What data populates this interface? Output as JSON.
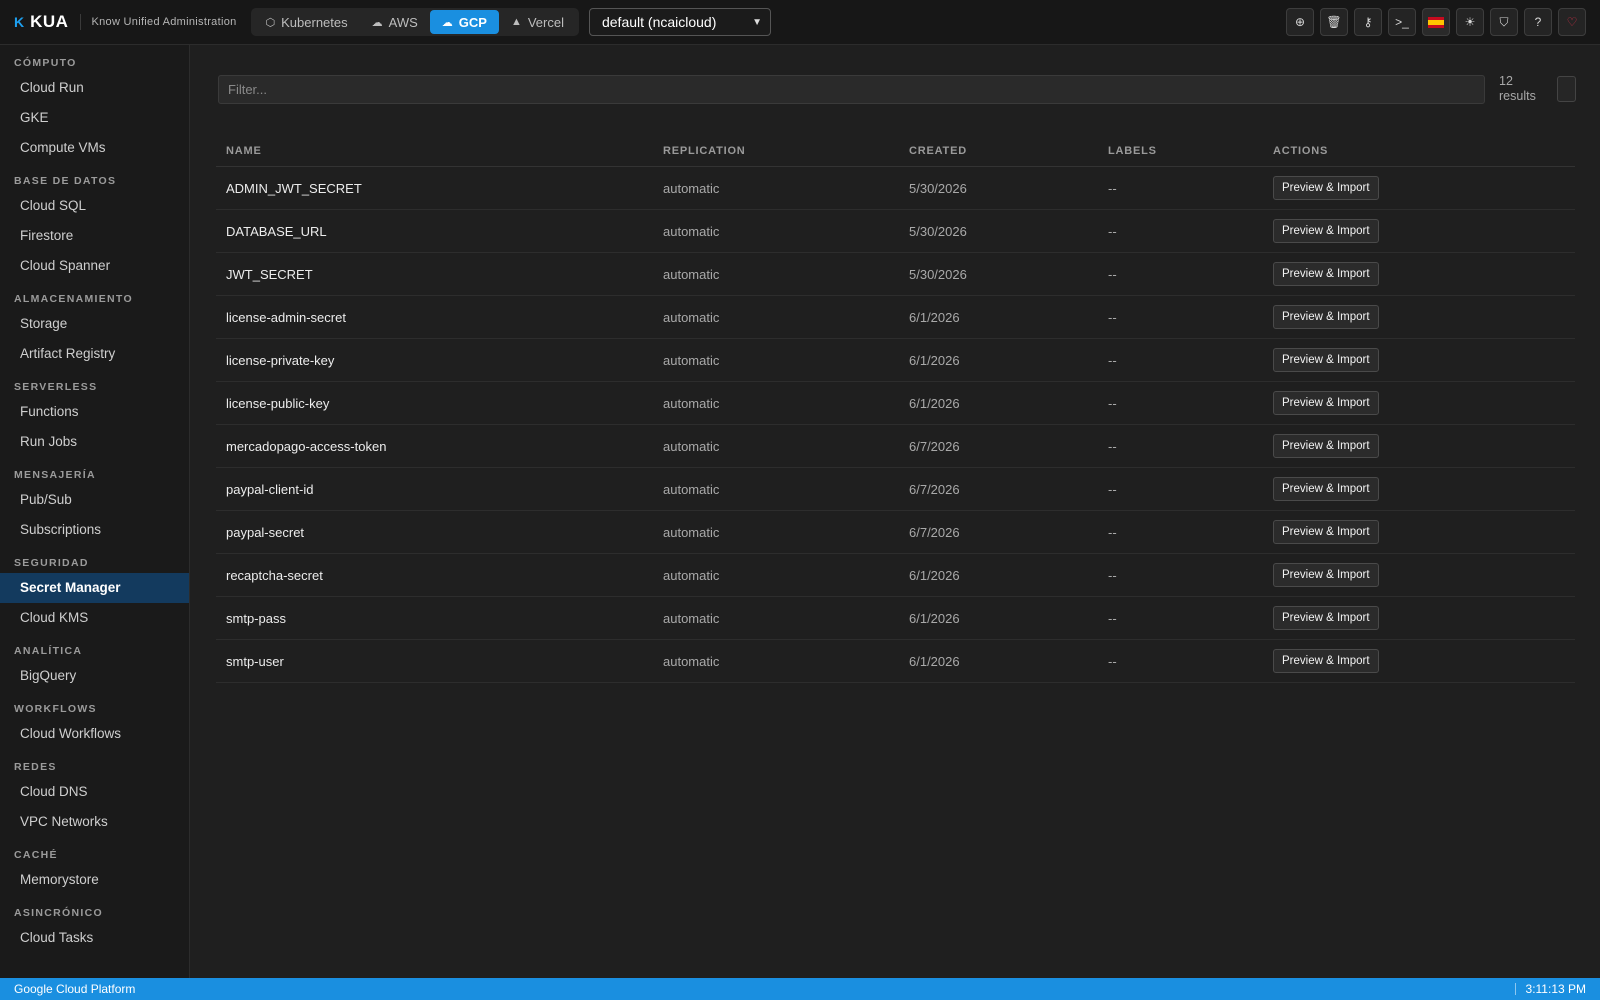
{
  "app": {
    "mark": "K",
    "name": "KUA",
    "subtitle": "Know Unified Administration"
  },
  "providers": [
    {
      "label": "Kubernetes",
      "icon": "⬡",
      "active": false
    },
    {
      "label": "AWS",
      "icon": "☁",
      "active": false
    },
    {
      "label": "GCP",
      "icon": "☁",
      "active": true
    },
    {
      "label": "Vercel",
      "icon": "▲",
      "active": false
    }
  ],
  "project": {
    "selected": "default (ncaicloud)"
  },
  "tools": {
    "add": "⊕",
    "trash": "🗑",
    "key": "⚷",
    "terminal": ">_",
    "theme": "☀",
    "shield": "⛉",
    "help": "?",
    "heart": "♡"
  },
  "sidebar": {
    "sections": [
      {
        "heading": "CÓMPUTO",
        "items": [
          "Cloud Run",
          "GKE",
          "Compute VMs"
        ]
      },
      {
        "heading": "BASE DE DATOS",
        "items": [
          "Cloud SQL",
          "Firestore",
          "Cloud Spanner"
        ]
      },
      {
        "heading": "ALMACENAMIENTO",
        "items": [
          "Storage",
          "Artifact Registry"
        ]
      },
      {
        "heading": "SERVERLESS",
        "items": [
          "Functions",
          "Run Jobs"
        ]
      },
      {
        "heading": "MENSAJERÍA",
        "items": [
          "Pub/Sub",
          "Subscriptions"
        ]
      },
      {
        "heading": "SEGURIDAD",
        "items": [
          "Secret Manager",
          "Cloud KMS"
        ]
      },
      {
        "heading": "ANALÍTICA",
        "items": [
          "BigQuery"
        ]
      },
      {
        "heading": "WORKFLOWS",
        "items": [
          "Cloud Workflows"
        ]
      },
      {
        "heading": "REDES",
        "items": [
          "Cloud DNS",
          "VPC Networks"
        ]
      },
      {
        "heading": "CACHÉ",
        "items": [
          "Memorystore"
        ]
      },
      {
        "heading": "ASINCRÓNICO",
        "items": [
          "Cloud Tasks"
        ]
      }
    ],
    "active_item": "Secret Manager"
  },
  "filter": {
    "placeholder": "Filter...",
    "count_number": "12",
    "count_label": "results"
  },
  "table": {
    "headers": {
      "name": "NAME",
      "replication": "REPLICATION",
      "created": "CREATED",
      "labels": "LABELS",
      "actions": "ACTIONS"
    },
    "action_label": "Preview & Import",
    "rows": [
      {
        "name": "ADMIN_JWT_SECRET",
        "replication": "automatic",
        "created": "5/30/2026",
        "labels": "--"
      },
      {
        "name": "DATABASE_URL",
        "replication": "automatic",
        "created": "5/30/2026",
        "labels": "--"
      },
      {
        "name": "JWT_SECRET",
        "replication": "automatic",
        "created": "5/30/2026",
        "labels": "--"
      },
      {
        "name": "license-admin-secret",
        "replication": "automatic",
        "created": "6/1/2026",
        "labels": "--"
      },
      {
        "name": "license-private-key",
        "replication": "automatic",
        "created": "6/1/2026",
        "labels": "--"
      },
      {
        "name": "license-public-key",
        "replication": "automatic",
        "created": "6/1/2026",
        "labels": "--"
      },
      {
        "name": "mercadopago-access-token",
        "replication": "automatic",
        "created": "6/7/2026",
        "labels": "--"
      },
      {
        "name": "paypal-client-id",
        "replication": "automatic",
        "created": "6/7/2026",
        "labels": "--"
      },
      {
        "name": "paypal-secret",
        "replication": "automatic",
        "created": "6/7/2026",
        "labels": "--"
      },
      {
        "name": "recaptcha-secret",
        "replication": "automatic",
        "created": "6/1/2026",
        "labels": "--"
      },
      {
        "name": "smtp-pass",
        "replication": "automatic",
        "created": "6/1/2026",
        "labels": "--"
      },
      {
        "name": "smtp-user",
        "replication": "automatic",
        "created": "6/1/2026",
        "labels": "--"
      }
    ]
  },
  "status": {
    "left": "Google Cloud Platform",
    "time": "3:11:13 PM"
  },
  "colors": {
    "accent": "#1a8fe0",
    "active_nav": "#133a5e",
    "heart": "#e0314b"
  }
}
